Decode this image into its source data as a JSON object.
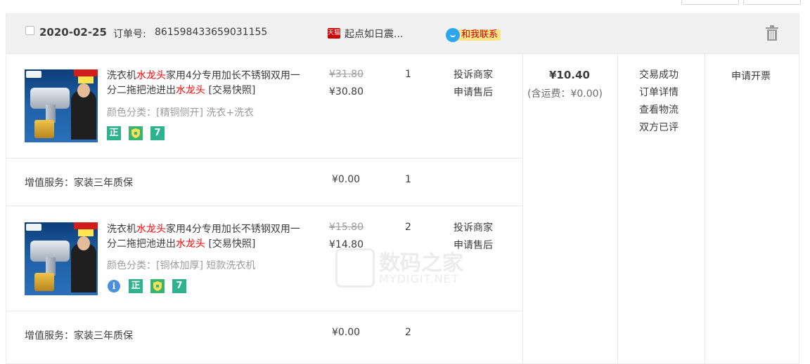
{
  "order": {
    "date": "2020-02-25",
    "order_no_label": "订单号:",
    "order_no": "861598433659031155",
    "shop_badge": "天猫",
    "shop_name": "起点如日震...",
    "contact_label": "和我联系",
    "total": "¥10.40",
    "shipping": "(含运费：¥0.00)",
    "status_items": [
      "交易成功",
      "订单详情",
      "查看物流",
      "双方已评"
    ],
    "invoice_label": "申请开票"
  },
  "items": [
    {
      "title_parts": [
        "洗衣机",
        "水龙头",
        "家用4分专用加长不锈钢双用一分二拖把池进出",
        "水龙头",
        " [交易快照]"
      ],
      "sku": "颜色分类：[精铜侧开] 洗衣+洗衣",
      "price_old": "¥31.80",
      "price_new": "¥30.80",
      "qty": "1",
      "ops": [
        "投诉商家",
        "申请售后"
      ],
      "icons": [
        "正",
        "shield",
        "7"
      ],
      "service_label": "增值服务：家装三年质保",
      "service_price": "¥0.00",
      "service_qty": "1"
    },
    {
      "title_parts": [
        "洗衣机",
        "水龙头",
        "家用4分专用加长不锈钢双用一分二拖把池进出",
        "水龙头",
        " [交易快照]"
      ],
      "sku": "颜色分类：[铜体加厚] 短款洗衣机",
      "price_old": "¥15.80",
      "price_new": "¥14.80",
      "qty": "2",
      "ops": [
        "投诉商家",
        "申请售后"
      ],
      "icons": [
        "i",
        "正",
        "shield",
        "7"
      ],
      "service_label": "增值服务：家装三年质保",
      "service_price": "¥0.00",
      "service_qty": "2"
    }
  ],
  "watermark": {
    "cn": "数码之家",
    "en": "MYDIGIT.NET"
  }
}
